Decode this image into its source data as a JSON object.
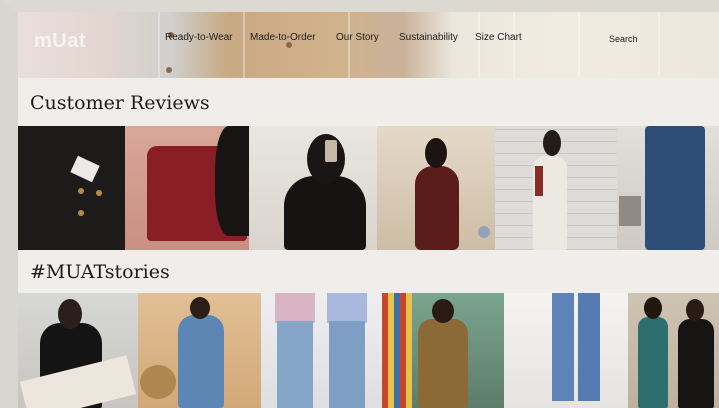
{
  "header": {
    "logo": "mUat",
    "nav": [
      "Ready-to-Wear",
      "Made-to-Order",
      "Our Story",
      "Sustainability",
      "Size Chart"
    ],
    "search_label": "Search"
  },
  "sections": {
    "reviews_title": "Customer Reviews",
    "stories_title": "#MUATstories"
  },
  "colors": {
    "page_bg": "#f0eeea",
    "text": "#1b1b1b",
    "nav_text": "#1e1e1e",
    "logo": "#f7f3ee"
  }
}
